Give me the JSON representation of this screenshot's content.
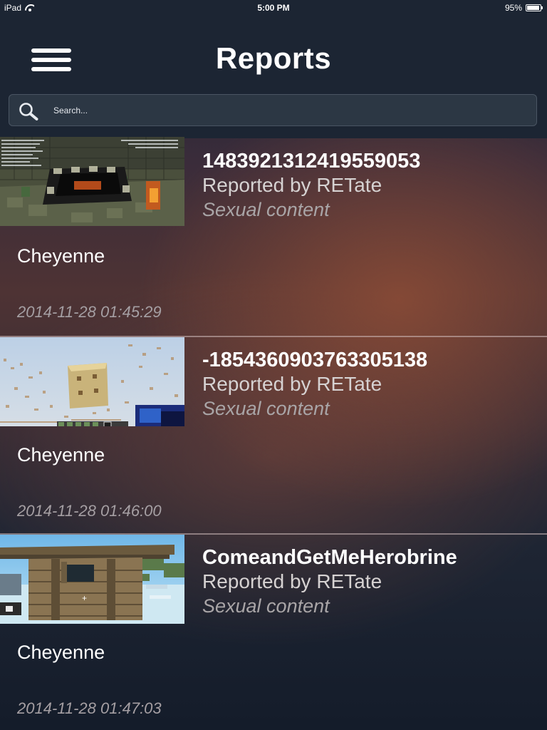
{
  "status_bar": {
    "device": "iPad",
    "time": "5:00 PM",
    "battery": "95%",
    "battery_level": 0.95
  },
  "nav": {
    "title": "Reports",
    "menu_icon": "hamburger-menu-icon"
  },
  "search": {
    "placeholder": "Search...",
    "value": "",
    "icon": "search-icon"
  },
  "reports": [
    {
      "id": "1483921312419559053",
      "reported_by": "Reported by RETate",
      "reason": "Sexual content",
      "owner": "Cheyenne",
      "timestamp": "2014-11-28 01:45:29",
      "thumbnail": "minecraft-screenshot-end-portal"
    },
    {
      "id": "-1854360903763305138",
      "reported_by": "Reported by RETate",
      "reason": "Sexual content",
      "owner": "Cheyenne",
      "timestamp": "2014-11-28 01:46:00",
      "thumbnail": "minecraft-screenshot-sand-tower"
    },
    {
      "id": "ComeandGetMeHerobrine",
      "reported_by": "Reported by RETate",
      "reason": "Sexual content",
      "owner": "Cheyenne",
      "timestamp": "2014-11-28 01:47:03",
      "thumbnail": "minecraft-screenshot-wooden-house"
    }
  ]
}
